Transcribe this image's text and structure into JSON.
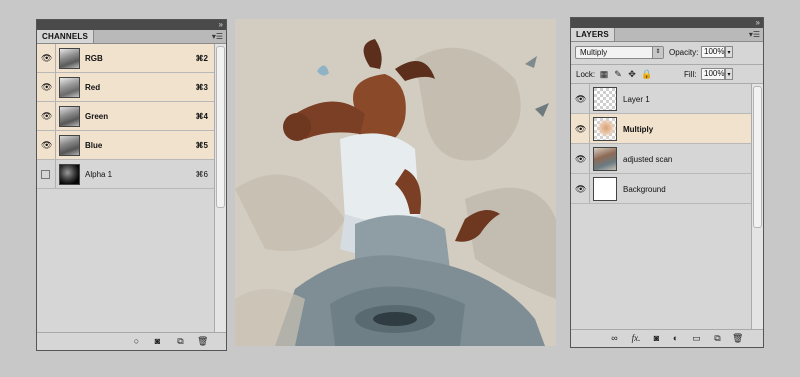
{
  "channels_panel": {
    "tab_label": "CHANNELS",
    "collapse_icon": "double-arrow-icon",
    "menu_icon": "panel-menu-icon",
    "channels": [
      {
        "name": "RGB",
        "shortcut": "⌘2",
        "visible": true,
        "selected": true
      },
      {
        "name": "Red",
        "shortcut": "⌘3",
        "visible": true,
        "selected": true
      },
      {
        "name": "Green",
        "shortcut": "⌘4",
        "visible": true,
        "selected": true
      },
      {
        "name": "Blue",
        "shortcut": "⌘5",
        "visible": true,
        "selected": true
      },
      {
        "name": "Alpha 1",
        "shortcut": "⌘6",
        "visible": false,
        "selected": false
      }
    ],
    "bottom_buttons": [
      "load-channel-as-selection-icon",
      "save-selection-as-channel-icon",
      "new-channel-icon",
      "delete-channel-icon"
    ]
  },
  "layers_panel": {
    "tab_label": "LAYERS",
    "blend_mode": "Multiply",
    "opacity_label": "Opacity:",
    "opacity_value": "100%",
    "lock_label": "Lock:",
    "fill_label": "Fill:",
    "fill_value": "100%",
    "layers": [
      {
        "name": "Layer 1",
        "visible": true,
        "selected": false
      },
      {
        "name": "Multiply",
        "visible": true,
        "selected": true
      },
      {
        "name": "adjusted scan",
        "visible": true,
        "selected": false
      },
      {
        "name": "Background",
        "visible": true,
        "selected": false
      }
    ],
    "bottom_buttons": [
      "link-layers-icon",
      "add-layer-style-icon",
      "add-mask-icon",
      "adjustment-layer-icon",
      "new-group-icon",
      "new-layer-icon",
      "delete-layer-icon"
    ],
    "fx_label": "fx."
  },
  "colors": {
    "selection_highlight": "#f1e2ce",
    "panel_bg": "#d6d6d6",
    "app_bg": "#c8c8c8",
    "panel_header": "#4a4a4a"
  }
}
